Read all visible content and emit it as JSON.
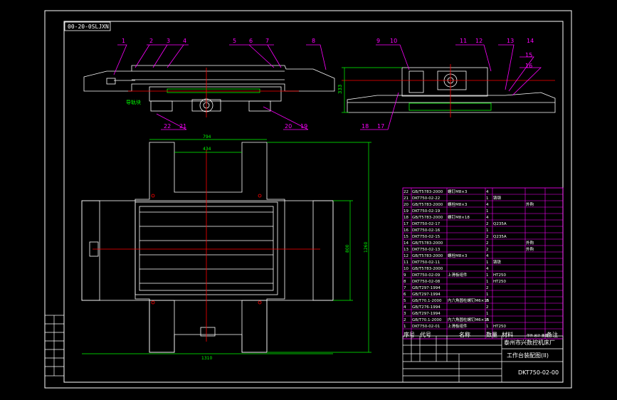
{
  "drawing_code": "00-20-0SLJXN",
  "dims": {
    "front_height": "333",
    "plan_width_top": "794",
    "plan_width_inner": "434",
    "plan_height": "800",
    "plan_height_outer": "1260",
    "plan_width_bottom": "1310"
  },
  "balloons": [
    "1",
    "2",
    "3",
    "4",
    "5",
    "6",
    "7",
    "8",
    "9",
    "10",
    "11",
    "12",
    "13",
    "14",
    "15",
    "16",
    "17",
    "18",
    "19",
    "20",
    "21",
    "22"
  ],
  "left_note": "导轨块",
  "bom": {
    "rows": [
      [
        "22",
        "GB/T5783-2000",
        "螺钉M8×3",
        "4",
        "",
        ""
      ],
      [
        "21",
        "DKT750-02-22",
        "",
        "1",
        "铸钢",
        ""
      ],
      [
        "20",
        "GB/T5783-2000",
        "螺栓M8×3",
        "4",
        "",
        "外购"
      ],
      [
        "19",
        "DKT750-02-19",
        "",
        "1",
        "",
        ""
      ],
      [
        "18",
        "GB/T5783-2000",
        "螺钉M8×18",
        "4",
        "",
        ""
      ],
      [
        "17",
        "DKT750-02-17",
        "",
        "2",
        "Q235A",
        ""
      ],
      [
        "16",
        "DKT750-02-16",
        "",
        "1",
        "",
        ""
      ],
      [
        "15",
        "DKT750-02-15",
        "",
        "2",
        "Q235A",
        ""
      ],
      [
        "14",
        "GB/T5783-2000",
        "",
        "2",
        "",
        "外购"
      ],
      [
        "13",
        "DKT750-02-13",
        "",
        "2",
        "",
        "外购"
      ],
      [
        "12",
        "GB/T5783-2000",
        "螺栓M8×3",
        "4",
        "",
        ""
      ],
      [
        "11",
        "DKT750-02-11",
        "",
        "1",
        "铸铁",
        ""
      ],
      [
        "10",
        "GB/T5783-2000",
        "",
        "4",
        "",
        ""
      ],
      [
        "9",
        "DKT750-02-09",
        "上滑板组件",
        "1",
        "HT250",
        ""
      ],
      [
        "8",
        "DKT750-02-08",
        "",
        "1",
        "HT250",
        ""
      ],
      [
        "7",
        "GB/T297-1994",
        "",
        "2",
        "",
        ""
      ],
      [
        "6",
        "GB/T297-1994",
        "",
        "1",
        "",
        ""
      ],
      [
        "5",
        "GB/T70.1-2000",
        "内六角圆柱螺钉M6×15",
        "8",
        "",
        ""
      ],
      [
        "4",
        "GB/T276-1994",
        "",
        "2",
        "",
        ""
      ],
      [
        "3",
        "GB/T297-1994",
        "",
        "1",
        "",
        ""
      ],
      [
        "2",
        "GB/T70.1-2000",
        "内六角圆柱螺钉M6×15",
        "8",
        "",
        ""
      ],
      [
        "1",
        "DKT750-02-01",
        "上滑板组件",
        "1",
        "HT250",
        ""
      ]
    ],
    "header": [
      "序号",
      "代号",
      "名称",
      "数量",
      "材料",
      "单件 总计 重量",
      "备注"
    ]
  },
  "title_block": {
    "company": "泰州市兴数控机床厂",
    "drawing_title": "工作台装配图(II)",
    "drawing_number": "DKT750-02-00"
  }
}
